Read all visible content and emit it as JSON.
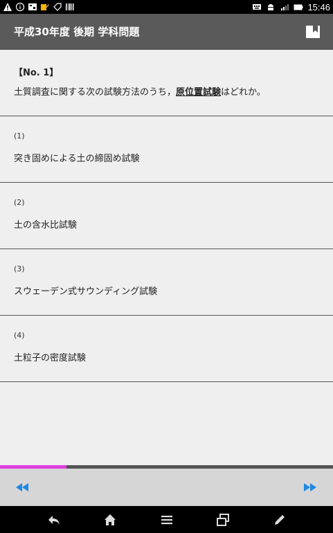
{
  "status_bar": {
    "time": "15:46"
  },
  "app_bar": {
    "title": "平成30年度 後期 学科問題"
  },
  "question": {
    "number": "【No. 1】",
    "text_before": "土質調査に関する次の試験方法のうち，",
    "text_emphasis": "原位置試験",
    "text_after": "はどれか。"
  },
  "options": [
    {
      "num": "(1)",
      "text": "突き固めによる土の締固め試験"
    },
    {
      "num": "(2)",
      "text": "土の含水比試験"
    },
    {
      "num": "(3)",
      "text": "スウェーデン式サウンディング試験"
    },
    {
      "num": "(4)",
      "text": "土粒子の密度試験"
    }
  ],
  "progress": {
    "fraction": 0.2,
    "color": "#e040e0"
  },
  "colors": {
    "app_bar": "#5a5a5a",
    "nav_arrows": "#1e88e5",
    "background": "#efefef"
  }
}
